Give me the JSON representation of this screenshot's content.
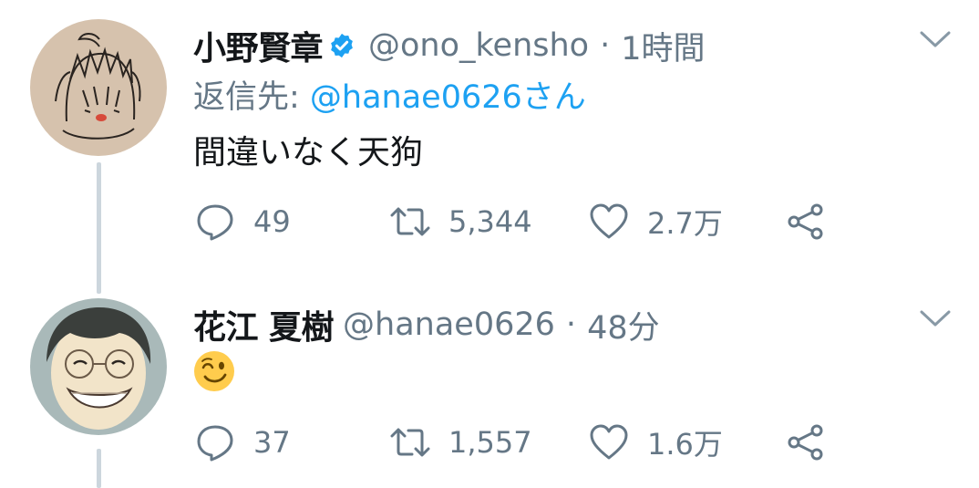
{
  "tweets": [
    {
      "display_name": "小野賢章",
      "verified": true,
      "handle": "@ono_kensho",
      "separator": "·",
      "time": "1時間",
      "reply_prefix": "返信先: ",
      "reply_to": "@hanae0626さん",
      "text": "間違いなく天狗",
      "actions": {
        "replies": "49",
        "retweets": "5,344",
        "likes": "2.7万"
      }
    },
    {
      "display_name": "花江 夏樹",
      "verified": false,
      "handle": "@hanae0626",
      "separator": "·",
      "time": "48分",
      "emoji": "winking-face",
      "actions": {
        "replies": "37",
        "retweets": "1,557",
        "likes": "1.6万"
      }
    }
  ],
  "colors": {
    "accent": "#1da1f2",
    "muted": "#657786",
    "text": "#14171a",
    "thread_line": "#ccd6dd"
  }
}
